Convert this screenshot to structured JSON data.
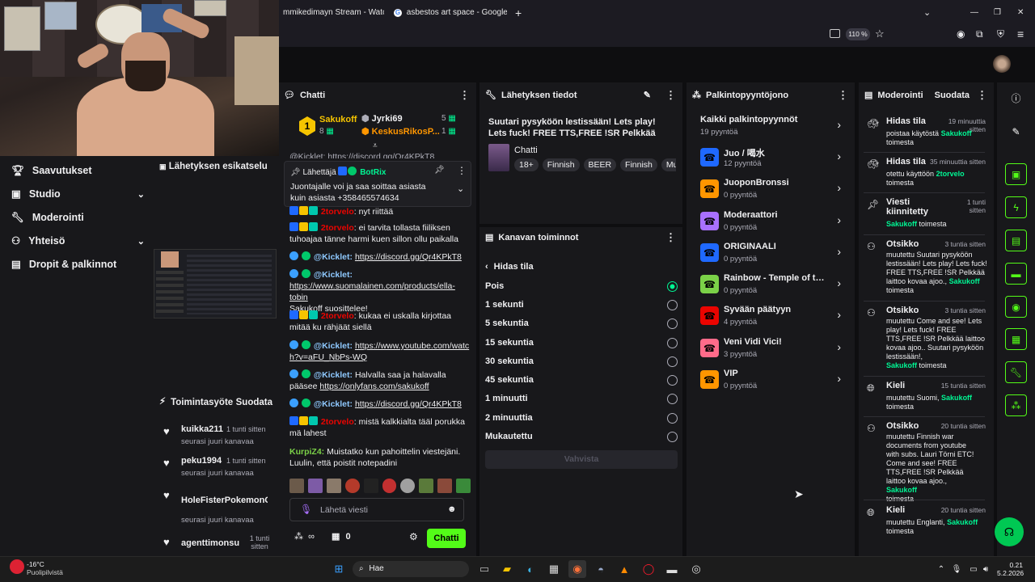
{
  "browser": {
    "tabs": [
      {
        "label": "mmikedimayn Stream - Watch L"
      },
      {
        "label": "asbestos art space - Google-ha"
      }
    ],
    "zoom": "110 %"
  },
  "left_nav": {
    "items": [
      {
        "label": "Saavutukset"
      },
      {
        "label": "Studio"
      },
      {
        "label": "Moderointi"
      },
      {
        "label": "Yhteisö"
      },
      {
        "label": "Dropit & palkinnot"
      }
    ]
  },
  "preview": {
    "title": "Lähetyksen esikatselu"
  },
  "activity": {
    "title": "Toimintasyöte",
    "filter": "Suodata",
    "items": [
      {
        "user": "kuikka211",
        "time": "1 tunti sitten",
        "text": "seurasi juuri kanavaa"
      },
      {
        "user": "peku1994",
        "time": "1 tunti sitten",
        "text": "seurasi juuri kanavaa"
      },
      {
        "user": "HoleFisterPokemonGo",
        "time": "",
        "text": "seurasi juuri kanavaa"
      },
      {
        "user": "agenttimonsu",
        "time": "1 tunti sitten",
        "text": ""
      }
    ]
  },
  "chat": {
    "title": "Chatti",
    "leaderboard": [
      {
        "rank": "1",
        "name": "Sakukoff",
        "count": "8"
      },
      {
        "name": "Jyrki69",
        "count": "5"
      },
      {
        "name": "KeskusRikosP...",
        "count": "1"
      }
    ],
    "pinned": {
      "label": "Lähettäjä",
      "user": "BotRix",
      "text": "Juontajalle voi ja saa soittaa asiasta kuin asiasta +358465574634"
    },
    "partial_top": "@Kicklet: https://discord.gg/Qr4KPkT8",
    "messages": [
      {
        "user": "2torvelo",
        "text": ": nyt riittää"
      },
      {
        "user": "2torvelo",
        "text": ": ei tarvita tollasta fiiliksen tuhoajaa tänne harmi kuen sillon ollu paikalla"
      },
      {
        "user": "@Kicklet:",
        "link": "https://discord.gg/Qr4KPkT8",
        "text": ""
      },
      {
        "user": "@Kicklet:",
        "link": "https://www.suomalainen.com/products/ella-tobin",
        "text": "Sakukoff suosittelee!"
      },
      {
        "user": "2torvelo",
        "text": ": kukaa ei uskalla kirjottaa mitää ku rähjäät siellä"
      },
      {
        "user": "@Kicklet:",
        "link": "https://www.youtube.com/watch?v=aFU_NbPs-WQ",
        "text": ""
      },
      {
        "user": "@Kicklet:",
        "text": "Halvalla saa ja halavalla pääsee",
        "link": "https://onlyfans.com/sakukoff"
      },
      {
        "user": "@Kicklet:",
        "link": "https://discord.gg/Qr4KPkT8",
        "text": ""
      },
      {
        "user": "2torvelo",
        "text": ": mistä kalkkialta tääl porukka mä lahest"
      },
      {
        "user": "KurpiZ4:",
        "text": "Muistatko kun pahoittelin viestejäni. Luulin, että poistit notepadini"
      }
    ],
    "input_placeholder": "Lähetä viesti",
    "points": "0",
    "send": "Chatti"
  },
  "stream_info": {
    "title": "Lähetyksen tiedot",
    "stream_title": "Suutari pysyköön lestissään! Lets play! Lets fuck! FREE TTS,FREE !SR Pelkkää laittoo kov...",
    "category": "Chatti",
    "tags": [
      "18+",
      "Finnish",
      "BEER",
      "Finnish",
      "Mu"
    ]
  },
  "channel_actions": {
    "title": "Kanavan toiminnot",
    "back": "Hidas tila",
    "options": [
      {
        "label": "Pois",
        "selected": true
      },
      {
        "label": "1 sekunti",
        "selected": false
      },
      {
        "label": "5 sekuntia",
        "selected": false
      },
      {
        "label": "15 sekuntia",
        "selected": false
      },
      {
        "label": "30 sekuntia",
        "selected": false
      },
      {
        "label": "45 sekuntia",
        "selected": false
      },
      {
        "label": "1 minuutti",
        "selected": false
      },
      {
        "label": "2 minuuttia",
        "selected": false
      },
      {
        "label": "Mukautettu",
        "selected": false
      }
    ],
    "confirm": "Vahvista"
  },
  "rewards": {
    "title": "Palkintopyyntöjono",
    "all": {
      "label": "Kaikki palkintopyynnöt",
      "count": "19 pyyntöä"
    },
    "items": [
      {
        "name": "Juo / 喝水",
        "count": "12 pyyntöä",
        "color": "#1f69ff"
      },
      {
        "name": "JuoponBronssi",
        "count": "0 pyyntöä",
        "color": "#ff9600"
      },
      {
        "name": "Moderaattori",
        "count": "0 pyyntöä",
        "color": "#a970ff"
      },
      {
        "name": "ORIGINAALI",
        "count": "0 pyyntöä",
        "color": "#1f69ff"
      },
      {
        "name": "Rainbow - Temple of the King",
        "count": "0 pyyntöä",
        "color": "#7bd148"
      },
      {
        "name": "Syvään päätyyn",
        "count": "4 pyyntöä",
        "color": "#eb0400"
      },
      {
        "name": "Veni Vidi Vici!",
        "count": "3 pyyntöä",
        "color": "#ff6b8a"
      },
      {
        "name": "VIP",
        "count": "0 pyyntöä",
        "color": "#ff9600"
      }
    ]
  },
  "moderation": {
    "title": "Moderointi",
    "filter": "Suodata",
    "entries": [
      {
        "icon": "slow-mode",
        "title": "Hidas tila",
        "time": "19 minuuttia sitten",
        "desc": "poistaa käytöstä",
        "who": "Sakukoff",
        "tail": "toimesta"
      },
      {
        "icon": "slow-mode",
        "title": "Hidas tila",
        "time": "35 minuuttia sitten",
        "desc": "otettu käyttöön",
        "who": "2torvelo",
        "tail": "toimesta"
      },
      {
        "icon": "pin",
        "title": "Viesti kiinnitetty",
        "time": "1 tunti sitten",
        "desc": "",
        "who": "Sakukoff",
        "tail": "toimesta"
      },
      {
        "icon": "title",
        "title": "Otsikko",
        "time": "3 tuntia sitten",
        "desc": "muutettu Suutari pysyköön lestissään! Lets play! Lets fuck! FREE TTS,FREE !SR Pelkkää laittoo kovaa ajoo.,",
        "who": "Sakukoff",
        "tail": "toimesta"
      },
      {
        "icon": "title",
        "title": "Otsikko",
        "time": "3 tuntia sitten",
        "desc": "muutettu Come and see! Lets play! Lets fuck! FREE TTS,FREE !SR Pelkkää laittoo kovaa ajoo.. Suutari pysyköön lestissään!,",
        "who": "Sakukoff",
        "tail": "toimesta"
      },
      {
        "icon": "language",
        "title": "Kieli",
        "time": "15 tuntia sitten",
        "desc": "muutettu Suomi,",
        "who": "Sakukoff",
        "tail": "toimesta"
      },
      {
        "icon": "title",
        "title": "Otsikko",
        "time": "20 tuntia sitten",
        "desc": "muutettu Finnish war documents from youtube with subs. Lauri Törni ETC! Come and see! FREE TTS,FREE !SR Pelkkää laittoo kovaa ajoo.,",
        "who": "Sakukoff",
        "tail": "toimesta"
      },
      {
        "icon": "language",
        "title": "Kieli",
        "time": "20 tuntia sitten",
        "desc": "muutettu Englanti,",
        "who": "Sakukoff",
        "tail": "toimesta"
      }
    ]
  },
  "taskbar": {
    "weather_temp": "-16°C",
    "weather_text": "Puolipilvistä",
    "search": "Hae",
    "time": "0.21",
    "date": "5.2.2026"
  }
}
